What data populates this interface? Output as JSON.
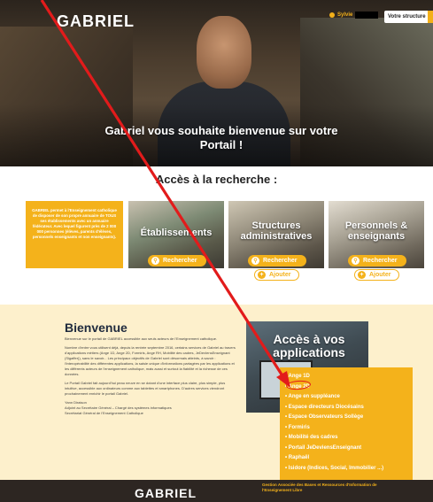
{
  "header": {
    "logo": "GABRIEL",
    "user_name": "Sylvie",
    "structure_button": "Votre structure"
  },
  "hero": {
    "welcome": "Gabriel vous souhaite bienvenue sur votre Portail !"
  },
  "search": {
    "title": "Accès à la recherche :",
    "intro": "GABRIEL permet à l'Enseignement catholique de disposer de son propre annuaire de TOUS ses établissements avec un annuaire fédérateur. Avec lequel figurent près de 2 000 000 personnes (élèves, parents d'élèves, personnels enseignants et non enseignants).",
    "cards": [
      {
        "label": "Établissements",
        "search_label": "Rechercher"
      },
      {
        "label": "Structures administratives",
        "search_label": "Rechercher",
        "add_label": "Ajouter"
      },
      {
        "label": "Personnels & enseignants",
        "search_label": "Rechercher",
        "add_label": "Ajouter"
      }
    ]
  },
  "bienvenue": {
    "title": "Bienvenue",
    "paragraphs": [
      "Bienvenue sur le portail de GABRIEL accessible aux seuls acteurs de l'Enseignement catholique.",
      "Nombre d'entre vous utilisent déjà, depuis la rentrée septembre 2016, certains services de Gabriel au travers d'applications métiers (Ange 1D, Ange 2D, Formiris, Ange RH, Mobilité des cadres, JeDevIensEnseignant (Sigaffer)), sans le savoir... Les principaux objectifs de Gabriel sont désormais atteints, à savoir : l'interopérabilité des différentes applications, la saisie unique d'informations partagées par les applications et les différents acteurs de l'enseignement catholique, mais aussi et surtout la fiabilité et la richesse de ces données.",
      "Le Portail Gabriel fait aujourd'hui peau neuve en se dotant d'une interface plus claire, plus simple, plus intuitive, accessible aux ordinateurs comme aux tablettes et smartphones. D'autres services viendront prochainement enrichir le portail Gabriel.",
      "Yann Diraison",
      "Adjoint au Secrétaire Général – Chargé des systèmes informatiques",
      "Secrétariat Général de l'Enseignement Catholique"
    ]
  },
  "apps": {
    "title": "Accès à vos applications",
    "items": [
      "Ange 1D",
      "Ange 2D",
      "Ange en suppléance",
      "Espace directeurs Diocésains",
      "Espace Observateurs Sollège",
      "Formiris",
      "Mobilité des cadres",
      "Portail JeDeviensEnseignant",
      "Raphaël",
      "Isidore (Indices, Social, Immobilier ...)"
    ]
  },
  "footer": {
    "logo": "GABRIEL",
    "text": "Gestion Associée des Bases et Ressources d'Information de l'Enseignement Libre"
  },
  "colors": {
    "accent": "#f4b21b",
    "annotation": "#e21b1b",
    "bienvenue_bg": "#fdf0cc"
  }
}
